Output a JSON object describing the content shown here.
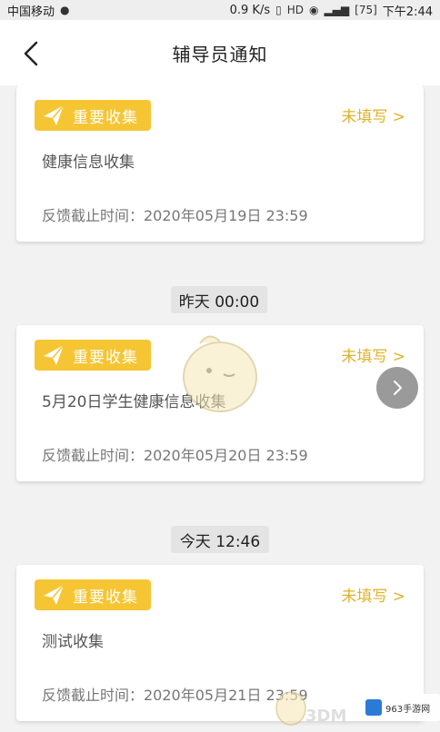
{
  "status_bar": {
    "carrier": "中国移动",
    "speed": "0.9 K/s",
    "time": "下午2:44",
    "battery_level": "75"
  },
  "header": {
    "title": "辅导员通知"
  },
  "cards": [
    {
      "tag": "重要收集",
      "status": "未填写 >",
      "title": "健康信息收集",
      "deadline": "反馈截止时间：2020年05月19日 23:59"
    },
    {
      "tag": "重要收集",
      "status": "未填写 >",
      "title": "5月20日学生健康信息收集",
      "deadline": "反馈截止时间：2020年05月20日 23:59"
    },
    {
      "tag": "重要收集",
      "status": "未填写 >",
      "title": "测试收集",
      "deadline": "反馈截止时间：2020年05月21日 23:59"
    }
  ],
  "time_labels": [
    "昨天 00:00",
    "今天 12:46"
  ],
  "watermarks": {
    "brand_3dm": "3DM",
    "brand_963": "963手游网"
  },
  "colors": {
    "accent_yellow": "#f5c534",
    "status_text": "#e1b128"
  },
  "icons": {
    "back": "chevron-left-icon",
    "tag": "paper-plane-icon",
    "float": "chevron-right-icon"
  }
}
